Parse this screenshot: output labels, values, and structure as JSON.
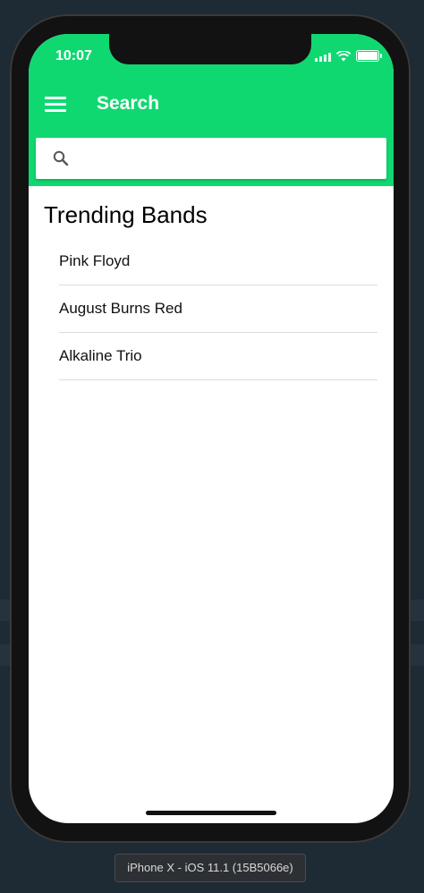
{
  "status_bar": {
    "time": "10:07"
  },
  "header": {
    "title": "Search"
  },
  "search": {
    "placeholder": ""
  },
  "section": {
    "title": "Trending Bands"
  },
  "bands": [
    "Pink Floyd",
    "August Burns Red",
    "Alkaline Trio"
  ],
  "simulator": {
    "device_label": "iPhone X - iOS 11.1 (15B5066e)"
  },
  "colors": {
    "accent": "#10d871",
    "frame": "#121212",
    "background": "#1e2a34"
  },
  "icons": {
    "menu": "hamburger-menu-icon",
    "search": "search-icon",
    "wifi": "wifi-icon",
    "battery": "battery-icon",
    "signal": "signal-icon"
  }
}
